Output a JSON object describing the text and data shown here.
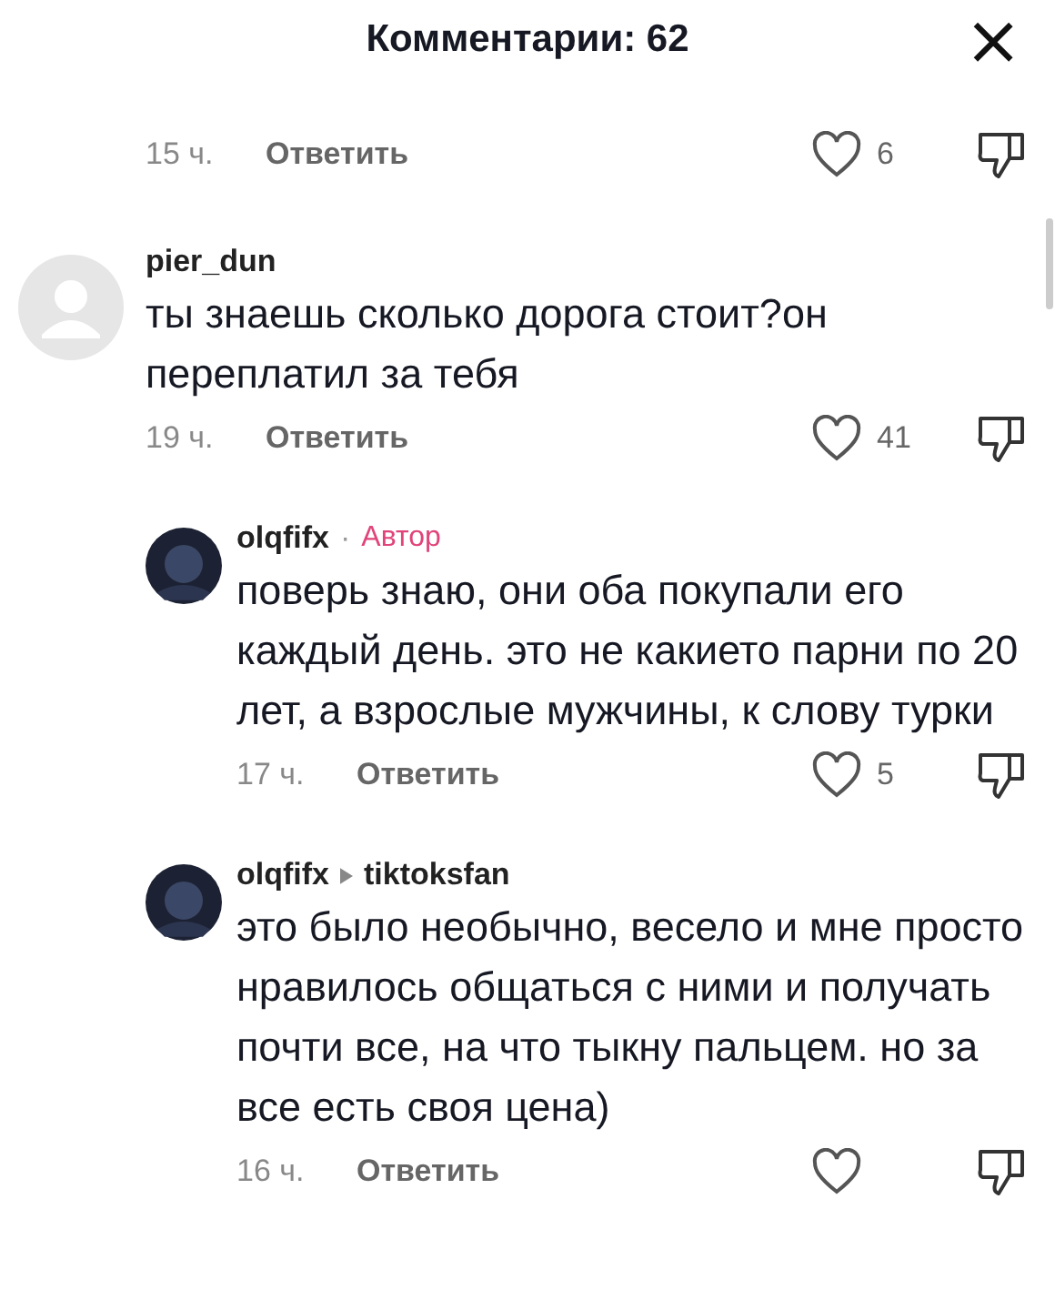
{
  "header": {
    "title": "Комментарии: 62",
    "close": "×"
  },
  "comments": [
    {
      "time": "15 ч.",
      "reply_label": "Ответить",
      "likes": "6"
    },
    {
      "author": "pier_dun",
      "kind": "default_avatar",
      "text": "ты знаешь сколько дорога стоит?он переплатил за тебя",
      "time": "19 ч.",
      "reply_label": "Ответить",
      "likes": "41",
      "replies": [
        {
          "author": "olqfifx",
          "separator": "·",
          "badge": "Автор",
          "text": "поверь знаю, они оба покупали его каждый день. это не какието парни по 20 лет, а взрослые мужчины, к слову турки",
          "time": "17 ч.",
          "reply_label": "Ответить",
          "likes": "5"
        },
        {
          "author": "olqfifx",
          "reply_to": "tiktoksfan",
          "text": "это было необычно, весело и мне просто нравилось общаться с ними и получать почти все, на что тыкну пальцем. но за все есть своя цена)",
          "time": "16 ч.",
          "reply_label": "Ответить"
        }
      ]
    }
  ]
}
